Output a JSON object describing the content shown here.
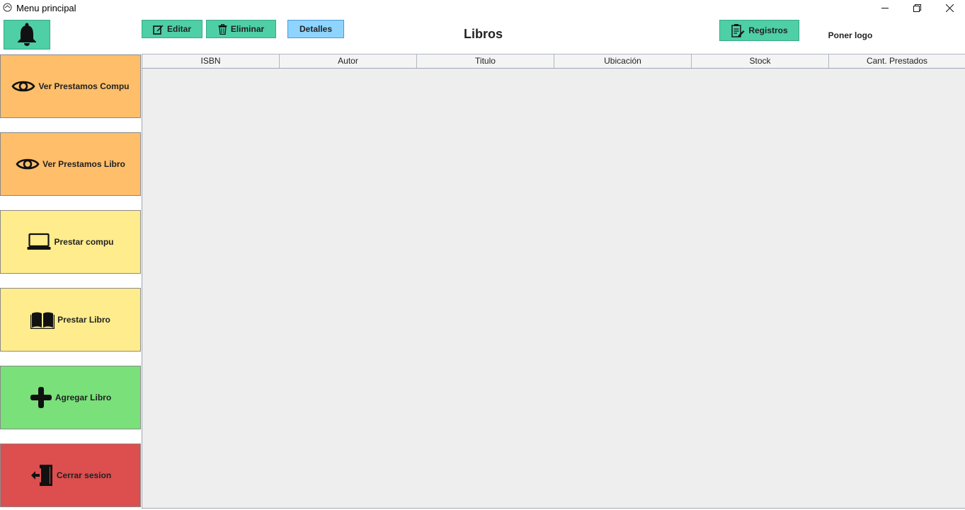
{
  "window": {
    "title": "Menu principal",
    "icons": {
      "app": "app-icon",
      "minimize": "minimize-icon",
      "maximize": "restore-icon",
      "close": "close-icon"
    }
  },
  "toolbar": {
    "bell_icon": "bell-icon",
    "edit_label": "Editar",
    "delete_label": "Eliminar",
    "details_label": "Detalles",
    "records_label": "Registros"
  },
  "header": {
    "title": "Libros",
    "logo_text": "Poner logo"
  },
  "sidebar": {
    "items": [
      {
        "label": "Ver Prestamos Compu",
        "icon": "eye-icon",
        "color": "#ffbe6a"
      },
      {
        "label": "Ver Prestamos Libro",
        "icon": "eye-icon",
        "color": "#ffbe6a"
      },
      {
        "label": "Prestar compu",
        "icon": "laptop-icon",
        "color": "#ffec8c"
      },
      {
        "label": "Prestar Libro",
        "icon": "book-icon",
        "color": "#ffec8c"
      },
      {
        "label": "Agregar Libro",
        "icon": "plus-icon",
        "color": "#79e07a"
      },
      {
        "label": "Cerrar sesion",
        "icon": "logout-icon",
        "color": "#dd4e4e"
      }
    ]
  },
  "table": {
    "columns": [
      "ISBN",
      "Autor",
      "Titulo",
      "Ubicación",
      "Stock",
      "Cant. Prestados"
    ],
    "rows": []
  },
  "colors": {
    "teal_button": "#4ecfa6",
    "blue_button": "#8ed4ff",
    "table_background": "#eeeeee"
  }
}
